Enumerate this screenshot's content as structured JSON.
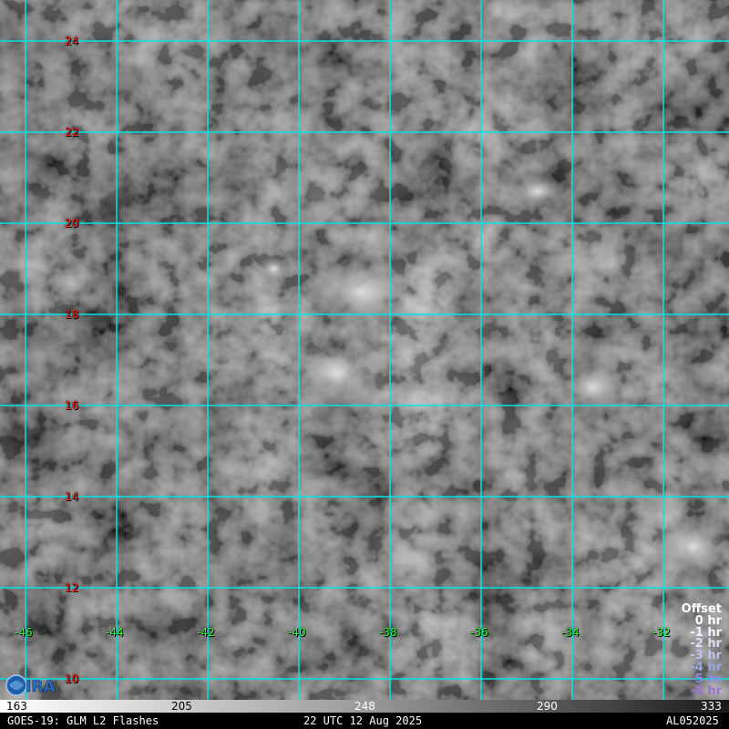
{
  "map": {
    "lat_labels": [
      "24",
      "22",
      "20",
      "18",
      "16",
      "14",
      "12",
      "10"
    ],
    "lon_labels": [
      "-46",
      "-44",
      "-42",
      "-40",
      "-38",
      "-36",
      "-34",
      "-32"
    ],
    "grid_color": "#00e5e5",
    "lat_label_color": "#ff2020",
    "lon_label_color": "#2bff2b"
  },
  "legend": {
    "title": "Offset",
    "items": [
      {
        "label": "0 hr",
        "color": "#ffffff"
      },
      {
        "label": "-1 hr",
        "color": "#f0f0ff"
      },
      {
        "label": "-2 hr",
        "color": "#dcdcf5"
      },
      {
        "label": "-3 hr",
        "color": "#bcc6ee"
      },
      {
        "label": "-4 hr",
        "color": "#9aa8e6"
      },
      {
        "label": "-5 hr",
        "color": "#8a8ae0"
      },
      {
        "label": "-6 hr",
        "color": "#a070d0"
      }
    ]
  },
  "colorbar": {
    "ticks": [
      "163",
      "205",
      "248",
      "290",
      "333"
    ]
  },
  "footer": {
    "left": "GOES-19: GLM L2 Flashes",
    "center": "22 UTC 12 Aug 2025",
    "right": "AL052025"
  }
}
